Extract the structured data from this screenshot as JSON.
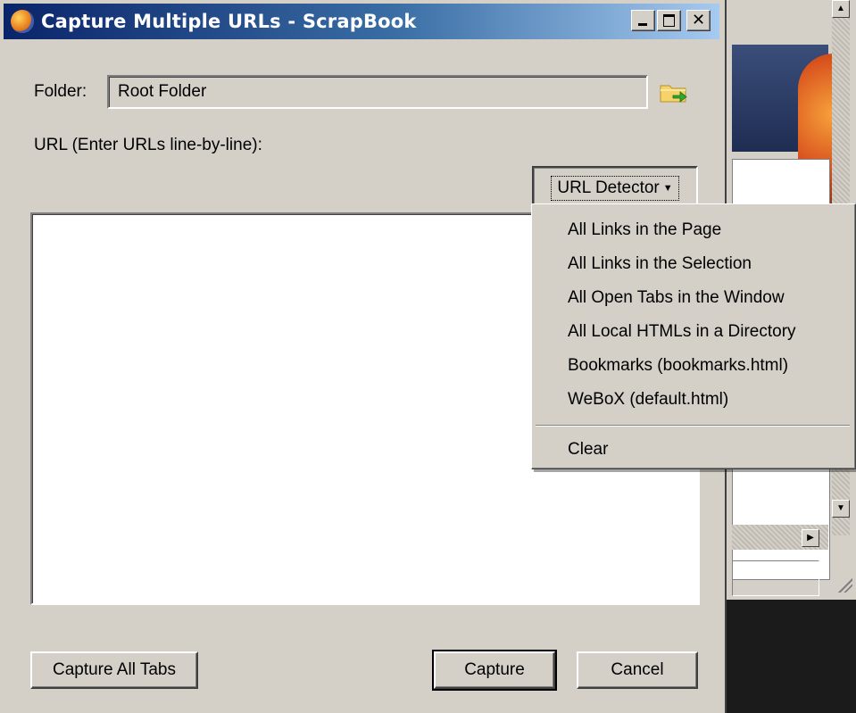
{
  "dialog": {
    "title": "Capture Multiple URLs - ScrapBook",
    "folder_label": "Folder:",
    "folder_value": "Root Folder",
    "url_label": "URL (Enter URLs line-by-line):",
    "url_text": "",
    "detector_label": "URL Detector",
    "capture_all_tabs_label": "Capture All Tabs",
    "capture_label": "Capture",
    "cancel_label": "Cancel"
  },
  "menu": {
    "items": [
      "All Links in the Page",
      "All Links in the Selection",
      "All Open Tabs in the Window",
      "All Local HTMLs in a Directory",
      "Bookmarks (bookmarks.html)",
      "WeBoX (default.html)"
    ],
    "clear_label": "Clear"
  },
  "icons": {
    "app": "firefox-icon",
    "folder": "folder-arrow-icon",
    "minimize": "minimize-icon",
    "maximize": "maximize-icon",
    "close": "close-icon"
  },
  "colors": {
    "titlebar_start": "#0a246a",
    "titlebar_end": "#a6caf0",
    "face": "#d4d0c8"
  }
}
